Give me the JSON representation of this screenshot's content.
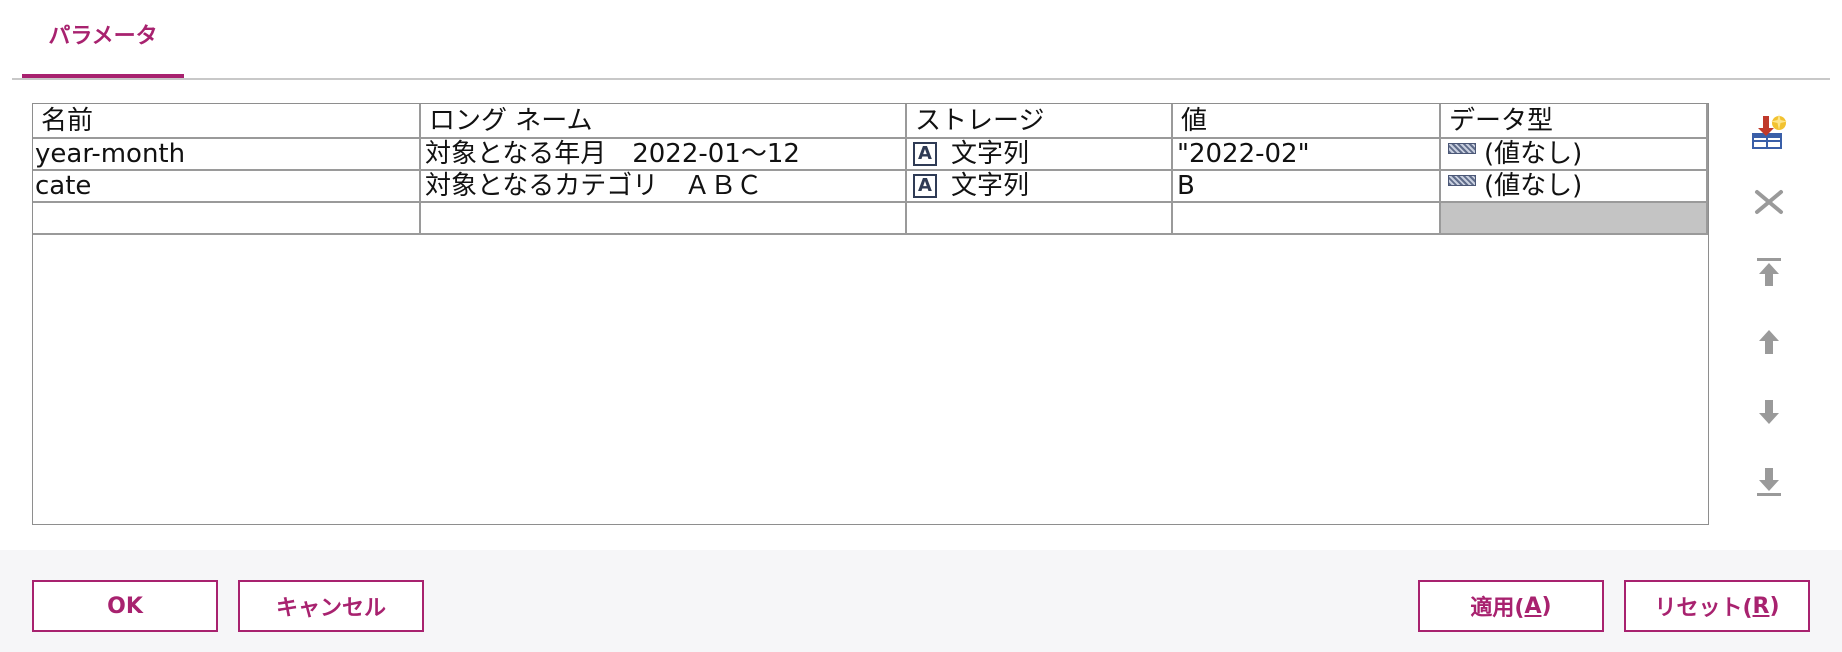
{
  "tabs": [
    {
      "label": "パラメータ",
      "active": true
    }
  ],
  "table": {
    "columns": [
      "名前",
      "ロング ネーム",
      "ストレージ",
      "値",
      "データ型"
    ],
    "rows": [
      {
        "name": "year-month",
        "long_name": "対象となる年月　2022-01～12",
        "storage_icon": "A",
        "storage": "文字列",
        "value": "\"2022-02\"",
        "datatype": "(値なし)"
      },
      {
        "name": "cate",
        "long_name": "対象となるカテゴリ　ＡＢＣ",
        "storage_icon": "A",
        "storage": "文字列",
        "value": "B",
        "datatype": "(値なし)"
      }
    ]
  },
  "toolbar": {
    "icons": [
      "add-parameter-icon",
      "delete-icon",
      "move-to-top-icon",
      "move-up-icon",
      "move-down-icon",
      "move-to-bottom-icon"
    ]
  },
  "footer": {
    "ok_label": "OK",
    "cancel_label": "キャンセル",
    "apply_label": "適用(",
    "apply_mnemonic": "A",
    "reset_label": "リセット(",
    "reset_mnemonic": "R",
    "mnemonic_close": ")"
  },
  "colors": {
    "accent": "#a8226f",
    "grid_line": "#9a9a9a",
    "disabled_cell": "#c4c4c4",
    "footer_bg": "#f6f6f8"
  }
}
